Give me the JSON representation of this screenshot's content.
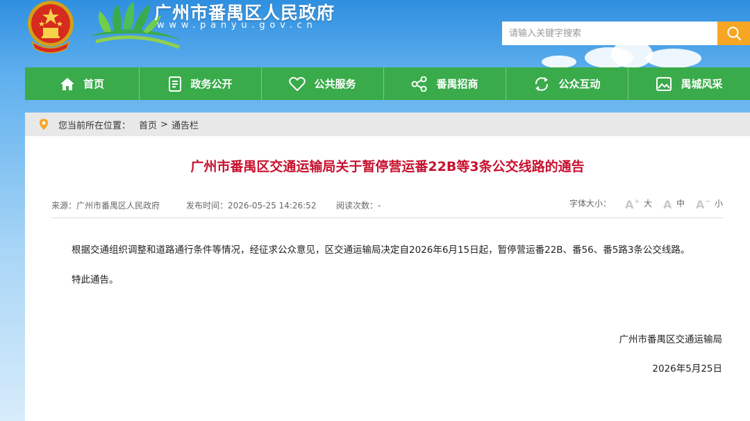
{
  "header": {
    "site_title": "广州市番禺区人民政府",
    "site_url": "www.panyu.gov.cn",
    "search": {
      "placeholder": "请输入关键字搜索"
    }
  },
  "nav": {
    "items": [
      {
        "label": "首页",
        "icon": "home-icon"
      },
      {
        "label": "政务公开",
        "icon": "document-icon"
      },
      {
        "label": "公共服务",
        "icon": "heart-icon"
      },
      {
        "label": "番禺招商",
        "icon": "share-nodes-icon"
      },
      {
        "label": "公众互动",
        "icon": "refresh-icon"
      },
      {
        "label": "禺城风采",
        "icon": "image-icon"
      }
    ]
  },
  "breadcrumb": {
    "prefix": "您当前所在位置：",
    "items": [
      "首页",
      "通告栏"
    ],
    "separator": ">"
  },
  "article": {
    "title": "广州市番禺区交通运输局关于暂停营运番22B等3条公交线路的通告",
    "source": "来源：广州市番禺区人民政府",
    "publish_time": "发布时间：2026-05-25 14:26:52",
    "views": "阅读次数：-",
    "font_size": {
      "label": "字体大小：",
      "large": "大",
      "medium": "中",
      "small": "小"
    },
    "paragraphs": [
      "根据交通组织调整和道路通行条件等情况，经征求公众意见，区交通运输局决定自2026年6月15日起，暂停营运番22B、番56、番5路3条公交线路。",
      "特此通告。"
    ],
    "signature_org": "广州市番禺区交通运输局",
    "signature_date": "2026年5月25日"
  },
  "colors": {
    "nav_green": "#3aab4b",
    "title_red": "#c8102e",
    "search_button": "#f6a623"
  }
}
